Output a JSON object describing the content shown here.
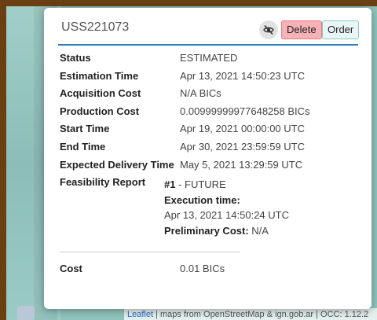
{
  "title": "USS221073",
  "buttons": {
    "delete": "Delete",
    "order": "Order"
  },
  "icons": {
    "hide": "eye-slash-icon"
  },
  "properties": [
    {
      "key": "Status",
      "value": "ESTIMATED"
    },
    {
      "key": "Estimation Time",
      "value": "Apr 13, 2021 14:50:23 UTC"
    },
    {
      "key": "Acquisition Cost",
      "value": "N/A BICs"
    },
    {
      "key": "Production Cost",
      "value": "0.00999999977648258 BICs"
    },
    {
      "key": "Start Time",
      "value": "Apr 19, 2021 00:00:00 UTC"
    },
    {
      "key": "End Time",
      "value": "Apr 30, 2021 23:59:59 UTC"
    },
    {
      "key": "Expected Delivery Time",
      "value": "May 5, 2021 13:29:59 UTC"
    }
  ],
  "feasibility": {
    "key": "Feasibility Report",
    "number": "#1",
    "status": " - FUTURE",
    "exec_label": "Execution time:",
    "exec_value": "Apr 13, 2021 14:50:24 UTC",
    "prelim_label": "Preliminary Cost:",
    "prelim_value": " N/A"
  },
  "cost": {
    "key": "Cost",
    "value": "0.01 BICs"
  },
  "attribution": {
    "leaflet": "Leaflet",
    "text": " | maps from OpenStreetMap & ign.gob.ar | OCC: 1.12.2"
  },
  "colors": {
    "frame": "#6b3f12",
    "accent_rule": "#2d7fc1",
    "delete_bg": "#f6b2b7",
    "order_bg": "#eaf6f6"
  }
}
